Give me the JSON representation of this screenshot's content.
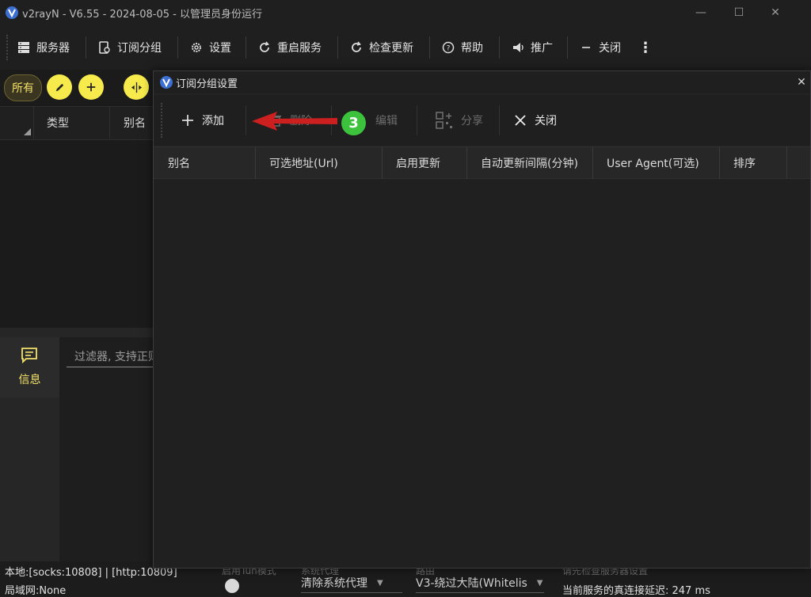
{
  "window": {
    "title": "v2rayN - V6.55 - 2024-08-05 - 以管理员身份运行",
    "controls": {
      "minimize": "—",
      "maximize": "☐",
      "close": "✕"
    }
  },
  "toolbar": {
    "items": [
      {
        "label": "服务器",
        "icon": "server-icon"
      },
      {
        "label": "订阅分组",
        "icon": "subscription-icon"
      },
      {
        "label": "设置",
        "icon": "gear-icon"
      },
      {
        "label": "重启服务",
        "icon": "restart-icon"
      },
      {
        "label": "检查更新",
        "icon": "check-update-icon"
      },
      {
        "label": "帮助",
        "icon": "help-icon"
      },
      {
        "label": "推广",
        "icon": "promote-icon"
      },
      {
        "label": "关闭",
        "icon": "minus-icon"
      }
    ],
    "more": "⋮"
  },
  "left_pane": {
    "filter_all": "所有",
    "columns": [
      "类型",
      "别名"
    ],
    "info_tab": "信息",
    "filter_placeholder": "过滤器, 支持正则"
  },
  "status_bar": {
    "local": "本地:[socks:10808] | [http:10809]",
    "lan": "局域网:None",
    "tun_label": "启用Tun模式",
    "sys_proxy_label": "系统代理",
    "sys_proxy_value": "清除系统代理",
    "routing_label": "路由",
    "routing_value": "V3-绕过大陆(Whitelis",
    "server_check_label": "请先检查服务器设置",
    "latency": "当前服务的真连接延迟: 247 ms"
  },
  "dialog": {
    "title": "订阅分组设置",
    "close": "✕",
    "toolbar": [
      {
        "label": "添加",
        "icon": "plus-icon",
        "enabled": true
      },
      {
        "label": "删除",
        "icon": "delete-icon",
        "enabled": false
      },
      {
        "label": "编辑",
        "icon": "edit-icon",
        "enabled": false
      },
      {
        "label": "分享",
        "icon": "qr-share-icon",
        "enabled": false
      },
      {
        "label": "关闭",
        "icon": "close-icon",
        "enabled": true
      }
    ],
    "columns": [
      "别名",
      "可选地址(Url)",
      "启用更新",
      "自动更新间隔(分钟)",
      "User Agent(可选)",
      "排序"
    ]
  },
  "annotation": {
    "step_number": "3",
    "arrow_color": "#cc1f1f",
    "badge_color": "#3cc23c"
  },
  "colors": {
    "accent_yellow": "#f6ea4c",
    "background": "#1e1e1e"
  }
}
